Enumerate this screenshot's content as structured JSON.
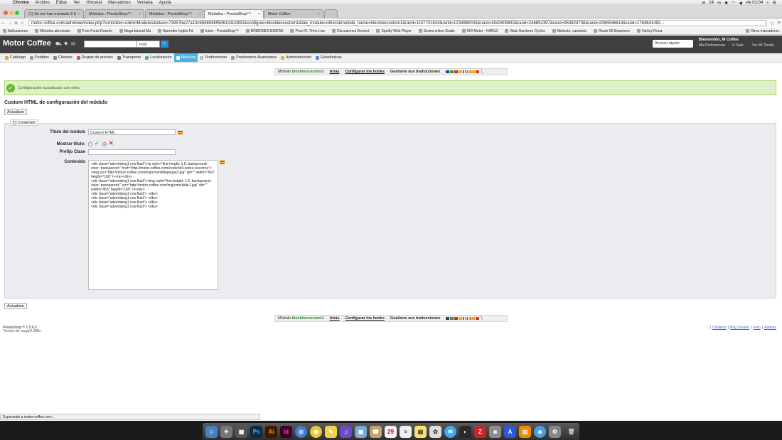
{
  "menubar": {
    "apple": "",
    "app": "Chrome",
    "items": [
      "Archivo",
      "Editar",
      "Ver",
      "Historial",
      "Marcadores",
      "Ventana",
      "Ayuda"
    ],
    "status_right": [
      "14",
      "vie 01:04"
    ]
  },
  "tabs": [
    "(1) Se me han montado 2 b",
    "Módulos › PrestaShop™",
    "Módulos › PrestaShop™",
    "Módulos › PrestaShop™",
    "Motor Coffee"
  ],
  "address": {
    "url": "motor-coffee.com/adminwe/index.php?controller=AdminModules&token=73957be27a13c98488369506104c1862&configure=blockleocustom1&tab_module=others&module_name=blockleocustom1&rand=1157701624&rand=1234960034&rand=1842609842&rand=246852397&rand=953824738&rand=2085536613&rand=1763641492..."
  },
  "bookmarks": {
    "items": [
      "Aplicaciones",
      "Métodos abreviado",
      "Free Fonts Downlo",
      "Mega tutorial Ma",
      "Aprender Inglés Fá",
      "Inicio - PrestaShop™",
      "BRIBONES BIKERS",
      "Povo Ft. Trine Lise",
      "Discusiones Recient",
      "Spotify Web Player",
      "Series online Gratis",
      "IHD Motor - HARLE",
      "Walz Hardcore Cycles",
      "Melicotó, camisete",
      "Route 66 Experienc",
      "Harley-Finca"
    ],
    "other": "Otros marcadores"
  },
  "header": {
    "brand": "Motor Coffee",
    "search_scope": "todo",
    "quick_access": "Acceso rápido",
    "welcome": "Bienvenido, M Coffee",
    "preferences": "Mis Preferencias",
    "logout": "Salir",
    "view_shop": "Ver Mi Tienda"
  },
  "menu": [
    "Catálogo",
    "Pedidos",
    "Clientes",
    "Reglas de precios",
    "Transporte",
    "Localización",
    "Módulos",
    "Preferencias",
    "Parámetros Avanzados",
    "Administración",
    "Estadísticas"
  ],
  "toolbar": {
    "module_prefix": "Módulo",
    "module_name": "blockleocustom1",
    "back": "Atrás",
    "hooks": "Configurar los hooks",
    "translations": "Gestione sus traducciones"
  },
  "success": "Configuración actualizado con éxito",
  "page_title": "Custom HTML de configuración del módulo",
  "update_label": "Actualizar",
  "legend": "Contenido",
  "form": {
    "title_label": "Título del módulo",
    "title_value": "Custom HTML",
    "show_title_label": "Mostrar título:",
    "prefix_label": "Prefijo Clase",
    "prefix_value": "",
    "content_label": "Contenido",
    "content_value": "<div class=\"advertising1 row-fluid\"><a style=\"line-height: 1.5; background-color: transparent;\" href=\"http://motor-coffee.com/content/4-sobre-nosotros\"><img src=\"http://motor-coffee.com/img/cms/slidepeque2.jpg\" alt=\"\" width=\"453\" height=\"160\" /></a></div>\n<div class=\"advertising1 row-fluid\"><img style=\"line-height: 1.5; background-color: transparent;\" src=\"http://motor-coffee.com/img/cms/slide1.jpg\" alt=\"\" width=\"453\" height=\"160\" /></div>\n<div class=\"advertising1 row-fluid\"> </div>\n<div class=\"advertising1 row-fluid\"> </div>\n<div class=\"advertising1 row-fluid\"> </div>\n<div class=\"advertising1 row-fluid\"> </div>"
  },
  "footer": {
    "version": "PrestaShop™ 1.5.6.2",
    "load_time": "Tiempo de cargaO.098s",
    "links": [
      "Contacto",
      "Bug Tracker",
      "Foro",
      "Addons"
    ]
  },
  "status_bar": "Esperando a motor-coffee.com...",
  "dock": {
    "calendar_day": "29"
  }
}
